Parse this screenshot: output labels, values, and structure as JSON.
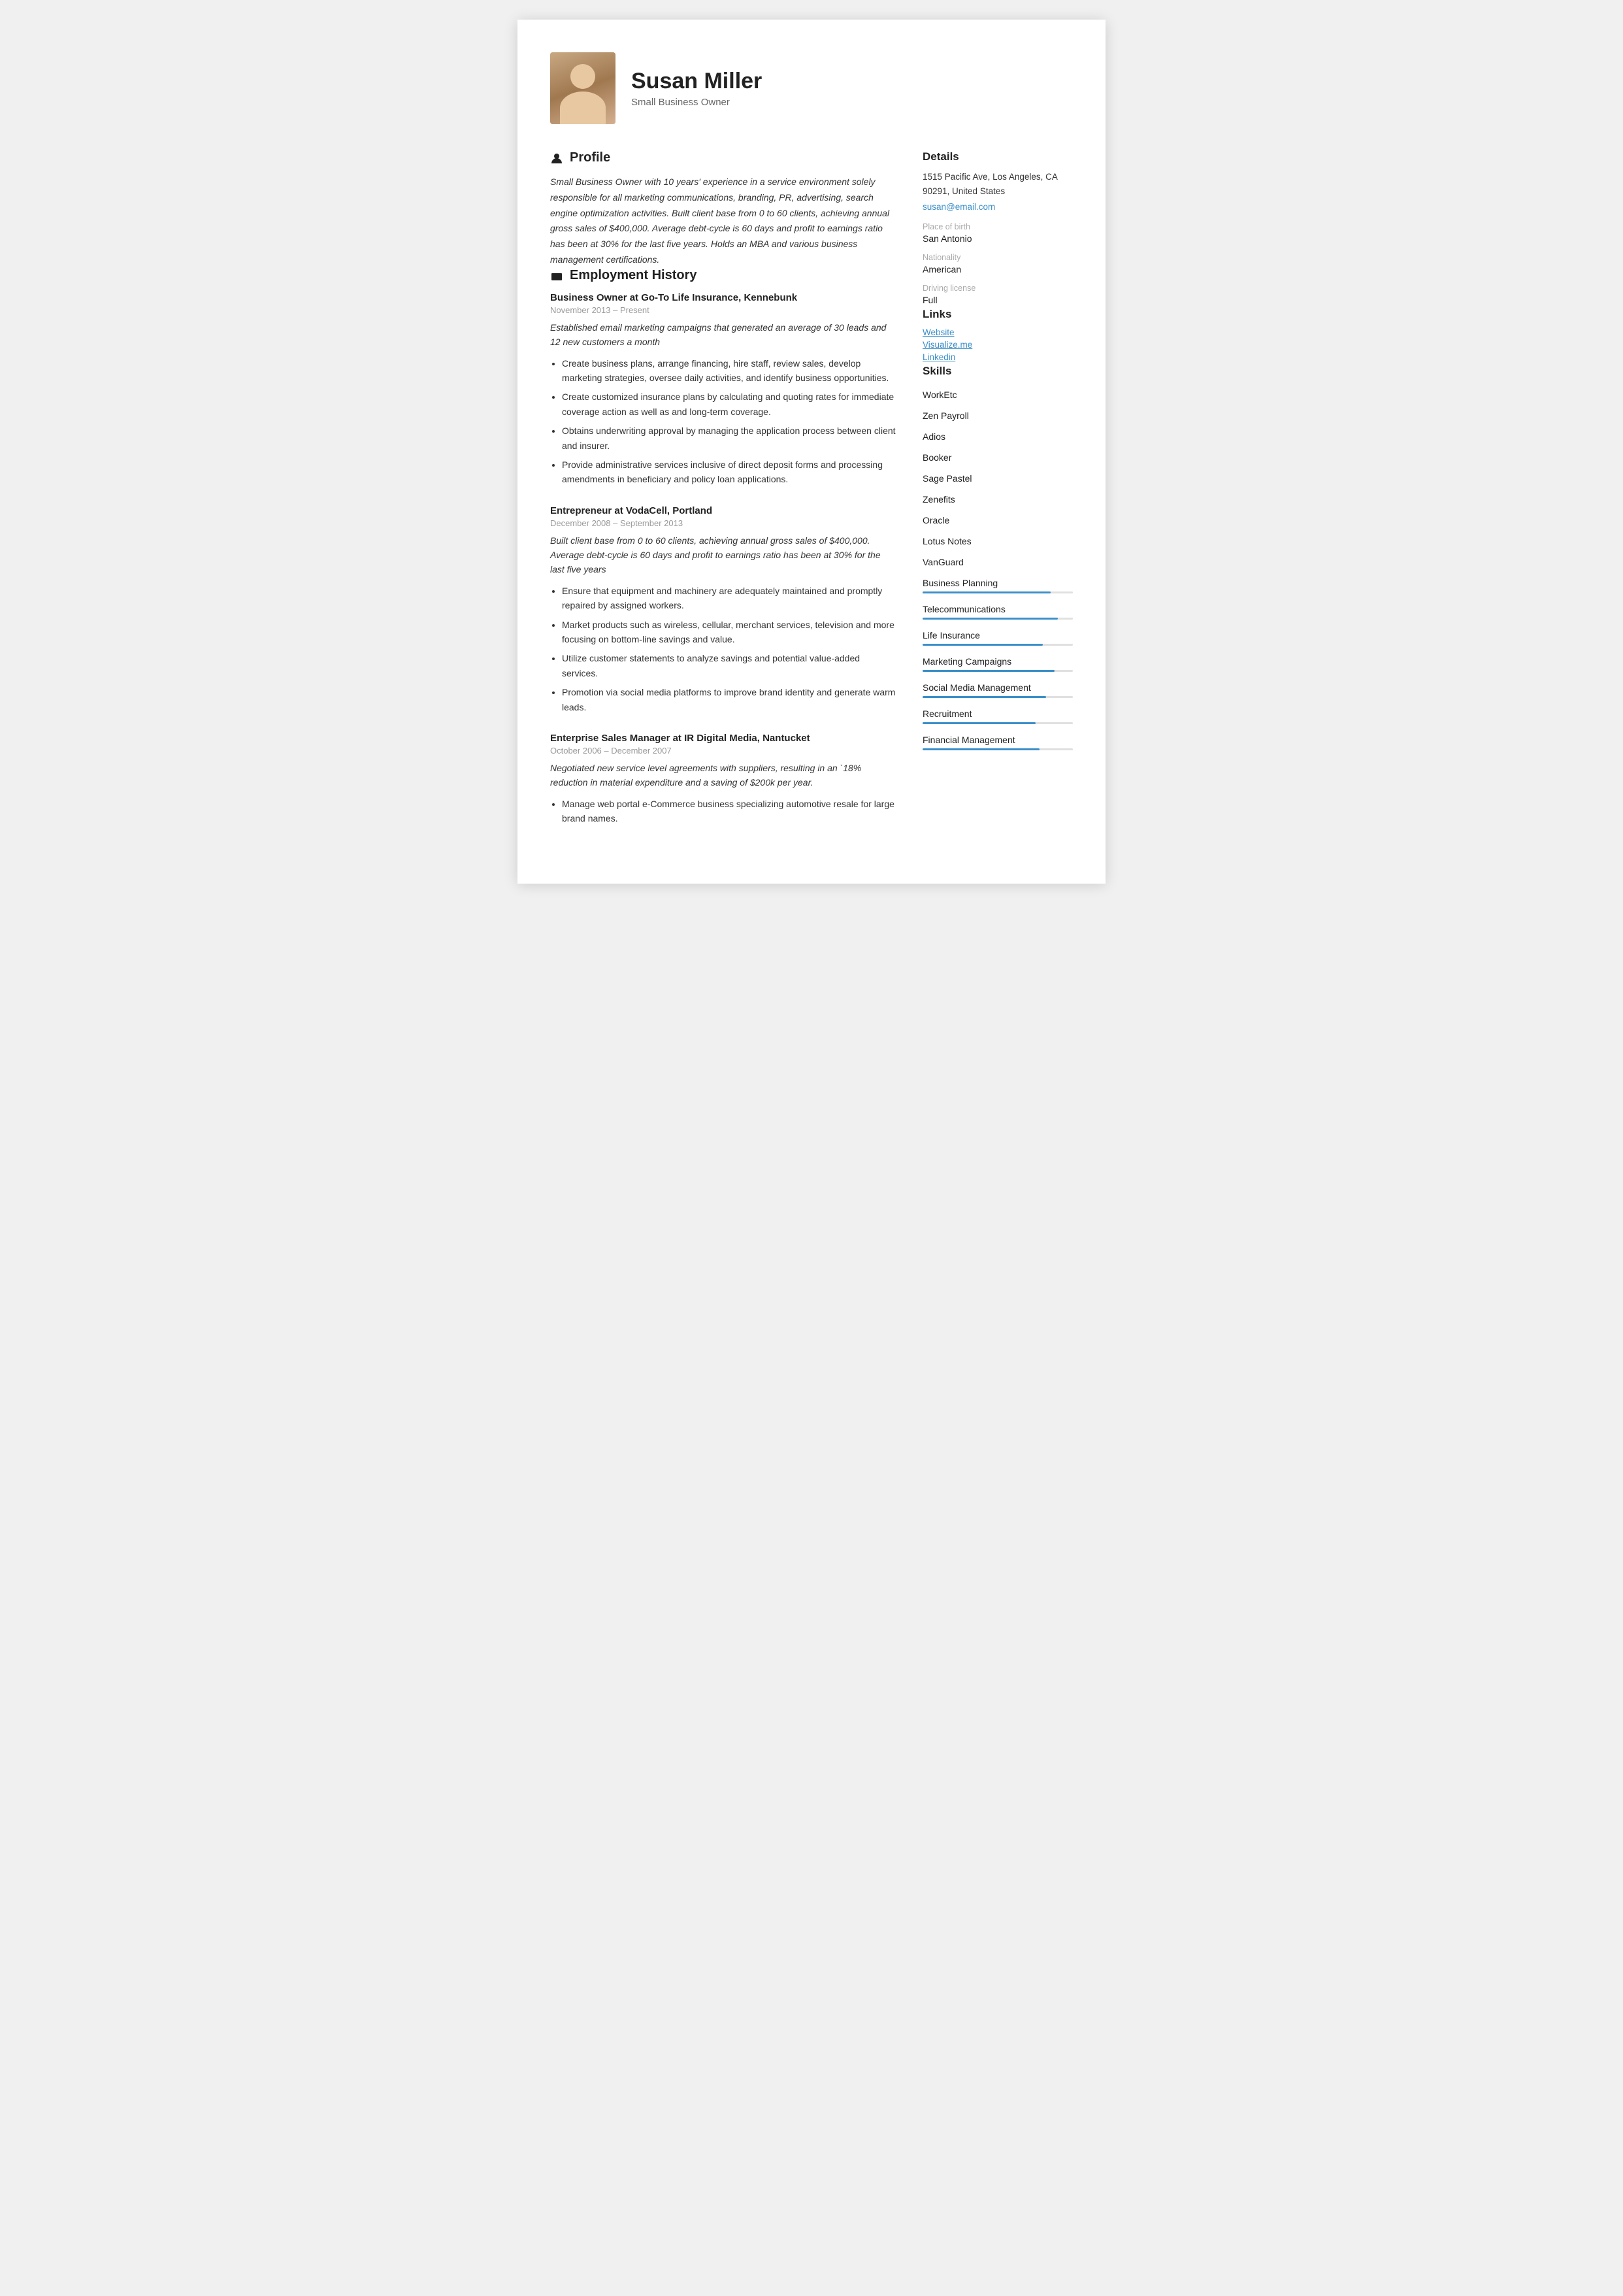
{
  "header": {
    "name": "Susan Miller",
    "subtitle": "Small Business Owner"
  },
  "profile": {
    "section_title": "Profile",
    "text": "Small Business Owner with 10 years' experience in a service environment solely responsible for all marketing communications, branding, PR, advertising, search engine optimization activities. Built client base from 0 to 60 clients, achieving annual gross sales of $400,000. Average debt-cycle is 60 days and profit to earnings ratio has been at 30% for the last five years. Holds an MBA and various business management certifications."
  },
  "employment": {
    "section_title": "Employment History",
    "jobs": [
      {
        "title": "Business Owner at Go-To Life Insurance, Kennebunk",
        "period": "November 2013 – Present",
        "summary": "Established email marketing campaigns that generated an average of 30 leads and 12 new customers a month",
        "bullets": [
          "Create business plans, arrange financing, hire staff, review sales, develop marketing strategies, oversee daily activities, and identify business opportunities.",
          "Create customized insurance plans by calculating and quoting rates for immediate coverage action as well as and long-term coverage.",
          "Obtains underwriting approval by managing the application process between client and insurer.",
          "Provide administrative services inclusive of direct deposit forms and processing amendments in beneficiary and policy loan applications."
        ]
      },
      {
        "title": "Entrepreneur at VodaCell, Portland",
        "period": "December 2008 – September 2013",
        "summary": "Built client base from 0 to 60 clients, achieving annual gross sales of $400,000. Average debt-cycle is 60 days and profit to earnings ratio has been at 30% for the last five years",
        "bullets": [
          "Ensure that equipment and machinery are adequately maintained and promptly repaired by assigned workers.",
          "Market products such as wireless, cellular, merchant services, television and more focusing on bottom-line savings and value.",
          "Utilize customer statements to analyze savings and potential value-added services.",
          "Promotion via social media platforms to improve brand identity and generate warm leads."
        ]
      },
      {
        "title": "Enterprise Sales Manager at IR Digital Media, Nantucket",
        "period": "October 2006 – December 2007",
        "summary": "Negotiated new service level agreements with suppliers, resulting in an `18% reduction in material expenditure and a saving of $200k per year.",
        "bullets": [
          "Manage web portal e-Commerce business specializing automotive resale for large brand names."
        ]
      }
    ]
  },
  "details": {
    "section_title": "Details",
    "address": "1515 Pacific Ave, Los Angeles, CA 90291, United States",
    "email": "susan@email.com",
    "place_of_birth_label": "Place of birth",
    "place_of_birth": "San Antonio",
    "nationality_label": "Nationality",
    "nationality": "American",
    "driving_license_label": "Driving license",
    "driving_license": "Full"
  },
  "links": {
    "section_title": "Links",
    "items": [
      "Website",
      "Visualize.me",
      "Linkedin"
    ]
  },
  "skills": {
    "section_title": "Skills",
    "items": [
      {
        "name": "WorkEtc",
        "has_bar": false
      },
      {
        "name": "Zen Payroll",
        "has_bar": false
      },
      {
        "name": "Adios",
        "has_bar": false
      },
      {
        "name": "Booker",
        "has_bar": false
      },
      {
        "name": "Sage Pastel",
        "has_bar": false
      },
      {
        "name": "Zenefits",
        "has_bar": false
      },
      {
        "name": "Oracle",
        "has_bar": false
      },
      {
        "name": "Lotus Notes",
        "has_bar": false
      },
      {
        "name": "VanGuard",
        "has_bar": false
      },
      {
        "name": "Business Planning",
        "has_bar": true,
        "fill": 85
      },
      {
        "name": "Telecommunications",
        "has_bar": true,
        "fill": 90
      },
      {
        "name": "Life Insurance",
        "has_bar": true,
        "fill": 80
      },
      {
        "name": "Marketing Campaigns",
        "has_bar": true,
        "fill": 88
      },
      {
        "name": "Social Media Management",
        "has_bar": true,
        "fill": 82
      },
      {
        "name": "Recruitment",
        "has_bar": true,
        "fill": 75
      },
      {
        "name": "Financial Management",
        "has_bar": true,
        "fill": 78
      }
    ]
  }
}
